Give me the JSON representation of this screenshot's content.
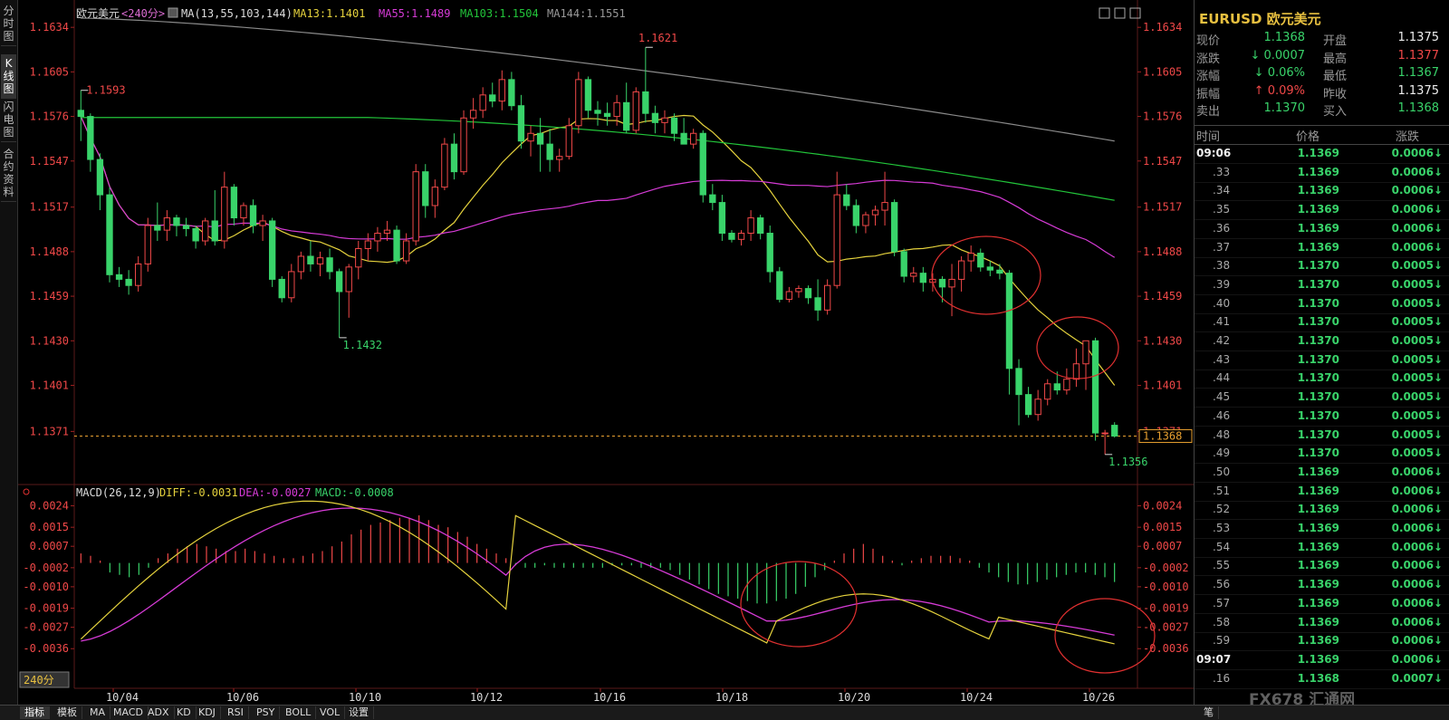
{
  "left_tabs": [
    "分时图",
    "K线图",
    "闪电图",
    "合约资料"
  ],
  "header": {
    "instrument": "欧元美元",
    "period": "<240分>",
    "ma_label": "MA(13,55,103,144)",
    "ma13": "MA13:1.1401",
    "ma55": "MA55:1.1489",
    "ma103": "MA103:1.1504",
    "ma144": "MA144:1.1551"
  },
  "macd_header": {
    "label": "MACD(26,12,9)",
    "diff": "DIFF:-0.0031",
    "dea": "DEA:-0.0027",
    "macd": "MACD:-0.0008"
  },
  "price_axis": [
    "1.1634",
    "1.1605",
    "1.1576",
    "1.1547",
    "1.1517",
    "1.1488",
    "1.1459",
    "1.1430",
    "1.1401",
    "1.1371"
  ],
  "price_axis_right_extra": "1.1368",
  "macd_axis": [
    "0.0024",
    "0.0015",
    "0.0007",
    "-0.0002",
    "-0.0010",
    "-0.0019",
    "-0.0027",
    "-0.0036"
  ],
  "date_labels": [
    "10/04",
    "10/06",
    "10/10",
    "10/12",
    "10/16",
    "10/18",
    "10/20",
    "10/24",
    "10/26"
  ],
  "period_box": "240分",
  "annotations": {
    "high": "1.1621",
    "left_high": "1.1593",
    "low1": "1.1432",
    "low2": "1.1356"
  },
  "colors": {
    "up": "#f04848",
    "down": "#39d36a",
    "ma13": "#e5d23d",
    "ma55": "#d63bd6",
    "ma103": "#22c53a",
    "ma144": "#8a8a8a",
    "circle": "#e03030"
  },
  "chart_data": {
    "type": "candlestick",
    "series_meta": [
      "open",
      "high",
      "low",
      "close"
    ],
    "candles": [
      [
        1.158,
        1.1593,
        1.156,
        1.1576
      ],
      [
        1.1576,
        1.1578,
        1.154,
        1.1548
      ],
      [
        1.1548,
        1.1552,
        1.1515,
        1.1525
      ],
      [
        1.1525,
        1.153,
        1.1468,
        1.1473
      ],
      [
        1.1473,
        1.1478,
        1.1465,
        1.147
      ],
      [
        1.147,
        1.1476,
        1.146,
        1.1466
      ],
      [
        1.1466,
        1.1485,
        1.1462,
        1.148
      ],
      [
        1.148,
        1.151,
        1.1475,
        1.1505
      ],
      [
        1.1505,
        1.152,
        1.1495,
        1.1502
      ],
      [
        1.1502,
        1.1515,
        1.1495,
        1.151
      ],
      [
        1.151,
        1.1512,
        1.1498,
        1.1505
      ],
      [
        1.1505,
        1.151,
        1.1498,
        1.1503
      ],
      [
        1.1503,
        1.1505,
        1.149,
        1.1495
      ],
      [
        1.1495,
        1.151,
        1.1492,
        1.1508
      ],
      [
        1.1508,
        1.1528,
        1.1492,
        1.1495
      ],
      [
        1.1495,
        1.154,
        1.149,
        1.153
      ],
      [
        1.153,
        1.1532,
        1.1505,
        1.151
      ],
      [
        1.151,
        1.152,
        1.1505,
        1.1518
      ],
      [
        1.1518,
        1.1522,
        1.15,
        1.1505
      ],
      [
        1.1505,
        1.1512,
        1.1495,
        1.1508
      ],
      [
        1.1508,
        1.151,
        1.1465,
        1.147
      ],
      [
        1.147,
        1.1472,
        1.1455,
        1.1458
      ],
      [
        1.1458,
        1.148,
        1.1455,
        1.1475
      ],
      [
        1.1475,
        1.1488,
        1.147,
        1.1485
      ],
      [
        1.1485,
        1.1495,
        1.1475,
        1.148
      ],
      [
        1.148,
        1.1488,
        1.1472,
        1.1484
      ],
      [
        1.1484,
        1.149,
        1.147,
        1.1475
      ],
      [
        1.1475,
        1.1477,
        1.1432,
        1.1462
      ],
      [
        1.1462,
        1.148,
        1.1445,
        1.1478
      ],
      [
        1.1478,
        1.1495,
        1.147,
        1.149
      ],
      [
        1.149,
        1.15,
        1.1482,
        1.1495
      ],
      [
        1.1495,
        1.1504,
        1.1488,
        1.15
      ],
      [
        1.15,
        1.1508,
        1.1495,
        1.1502
      ],
      [
        1.1502,
        1.1505,
        1.148,
        1.1482
      ],
      [
        1.1482,
        1.15,
        1.148,
        1.1495
      ],
      [
        1.1495,
        1.1545,
        1.1492,
        1.154
      ],
      [
        1.154,
        1.1545,
        1.151,
        1.1518
      ],
      [
        1.1518,
        1.1535,
        1.151,
        1.153
      ],
      [
        1.153,
        1.1562,
        1.1528,
        1.1558
      ],
      [
        1.1558,
        1.1565,
        1.1535,
        1.154
      ],
      [
        1.154,
        1.158,
        1.1538,
        1.1575
      ],
      [
        1.1575,
        1.1588,
        1.1568,
        1.158
      ],
      [
        1.158,
        1.1595,
        1.1575,
        1.159
      ],
      [
        1.159,
        1.1598,
        1.1582,
        1.1586
      ],
      [
        1.1586,
        1.1606,
        1.158,
        1.16
      ],
      [
        1.16,
        1.1605,
        1.158,
        1.1583
      ],
      [
        1.1583,
        1.159,
        1.1555,
        1.156
      ],
      [
        1.156,
        1.157,
        1.155,
        1.1565
      ],
      [
        1.1565,
        1.1575,
        1.154,
        1.1558
      ],
      [
        1.1558,
        1.1568,
        1.154,
        1.1548
      ],
      [
        1.1548,
        1.1555,
        1.154,
        1.155
      ],
      [
        1.155,
        1.1575,
        1.1548,
        1.157
      ],
      [
        1.157,
        1.1605,
        1.1565,
        1.16
      ],
      [
        1.16,
        1.1602,
        1.1575,
        1.158
      ],
      [
        1.158,
        1.1586,
        1.157,
        1.1578
      ],
      [
        1.1578,
        1.1585,
        1.157,
        1.1576
      ],
      [
        1.1576,
        1.159,
        1.157,
        1.1585
      ],
      [
        1.1585,
        1.1598,
        1.1565,
        1.1567
      ],
      [
        1.1567,
        1.1595,
        1.1565,
        1.1592
      ],
      [
        1.1592,
        1.1621,
        1.1572,
        1.1578
      ],
      [
        1.1578,
        1.1583,
        1.1565,
        1.1572
      ],
      [
        1.1572,
        1.158,
        1.1565,
        1.1575
      ],
      [
        1.1575,
        1.1578,
        1.156,
        1.1565
      ],
      [
        1.1565,
        1.1575,
        1.156,
        1.1558
      ],
      [
        1.1558,
        1.1568,
        1.1555,
        1.1565
      ],
      [
        1.1565,
        1.1567,
        1.152,
        1.1525
      ],
      [
        1.1525,
        1.1532,
        1.1515,
        1.152
      ],
      [
        1.152,
        1.1525,
        1.1495,
        1.15
      ],
      [
        1.15,
        1.1502,
        1.1494,
        1.1496
      ],
      [
        1.1496,
        1.1502,
        1.1492,
        1.15
      ],
      [
        1.15,
        1.1515,
        1.1495,
        1.151
      ],
      [
        1.151,
        1.1512,
        1.1496,
        1.15
      ],
      [
        1.15,
        1.1505,
        1.1468,
        1.1475
      ],
      [
        1.1475,
        1.1478,
        1.1455,
        1.1457
      ],
      [
        1.1457,
        1.1465,
        1.1455,
        1.1462
      ],
      [
        1.1462,
        1.1466,
        1.1458,
        1.1464
      ],
      [
        1.1464,
        1.1466,
        1.1454,
        1.1458
      ],
      [
        1.1458,
        1.147,
        1.1443,
        1.145
      ],
      [
        1.145,
        1.147,
        1.1447,
        1.1466
      ],
      [
        1.1466,
        1.154,
        1.1464,
        1.1525
      ],
      [
        1.1525,
        1.1532,
        1.1515,
        1.1518
      ],
      [
        1.1518,
        1.1522,
        1.15,
        1.1505
      ],
      [
        1.1505,
        1.1514,
        1.15,
        1.1512
      ],
      [
        1.1512,
        1.1518,
        1.1505,
        1.1515
      ],
      [
        1.1515,
        1.154,
        1.1505,
        1.152
      ],
      [
        1.152,
        1.1522,
        1.1485,
        1.1488
      ],
      [
        1.1488,
        1.149,
        1.1468,
        1.1472
      ],
      [
        1.1472,
        1.1478,
        1.1468,
        1.1474
      ],
      [
        1.1474,
        1.1478,
        1.1462,
        1.1468
      ],
      [
        1.1468,
        1.1474,
        1.1462,
        1.147
      ],
      [
        1.147,
        1.1472,
        1.1455,
        1.1465
      ],
      [
        1.1465,
        1.148,
        1.1446,
        1.147
      ],
      [
        1.147,
        1.1485,
        1.1462,
        1.1482
      ],
      [
        1.1482,
        1.1492,
        1.1475,
        1.1487
      ],
      [
        1.1487,
        1.149,
        1.1475,
        1.1478
      ],
      [
        1.1478,
        1.1482,
        1.1472,
        1.1476
      ],
      [
        1.1476,
        1.148,
        1.147,
        1.1474
      ],
      [
        1.1474,
        1.1476,
        1.1395,
        1.1412
      ],
      [
        1.1412,
        1.1418,
        1.1375,
        1.1395
      ],
      [
        1.1395,
        1.14,
        1.138,
        1.1382
      ],
      [
        1.1382,
        1.1398,
        1.1378,
        1.1392
      ],
      [
        1.1392,
        1.1405,
        1.1388,
        1.1402
      ],
      [
        1.1402,
        1.141,
        1.1395,
        1.1398
      ],
      [
        1.1398,
        1.1412,
        1.1395,
        1.1405
      ],
      [
        1.1405,
        1.1425,
        1.14,
        1.1415
      ],
      [
        1.1415,
        1.143,
        1.1398,
        1.143
      ],
      [
        1.143,
        1.1432,
        1.1365,
        1.137
      ],
      [
        1.137,
        1.1372,
        1.1356,
        1.137
      ],
      [
        1.1375,
        1.1377,
        1.1367,
        1.1368
      ]
    ],
    "ylim": [
      1.135,
      1.164
    ],
    "macd_ylim": [
      -0.0042,
      0.0028
    ],
    "macd_hist": [
      0.0004,
      0.0003,
      0.0001,
      -0.0004,
      -0.0005,
      -0.0006,
      -0.0005,
      -0.0002,
      0.0002,
      0.0004,
      0.0006,
      0.0007,
      0.0008,
      0.0007,
      0.0006,
      0.0005,
      0.0005,
      0.0006,
      0.0005,
      0.0004,
      0.0003,
      0.0002,
      0.0002,
      0.0003,
      0.0004,
      0.0005,
      0.0007,
      0.0009,
      0.0012,
      0.0014,
      0.0016,
      0.0017,
      0.0018,
      0.0019,
      0.0019,
      0.002,
      0.0018,
      0.0016,
      0.0015,
      0.0013,
      0.0011,
      0.0008,
      0.0006,
      0.0004,
      0.0002,
      -0.0001,
      -0.0002,
      -0.0002,
      -0.0001,
      -0.0002,
      -0.0002,
      -0.0002,
      -0.0002,
      -0.0002,
      -0.0002,
      -0.0001,
      -0.0001,
      -0.0001,
      -0.0002,
      -0.0002,
      -0.0002,
      -0.0003,
      -0.0005,
      -0.0007,
      -0.0009,
      -0.0011,
      -0.0013,
      -0.0014,
      -0.0015,
      -0.0016,
      -0.0017,
      -0.0017,
      -0.0016,
      -0.0015,
      -0.0013,
      -0.001,
      -0.0006,
      -0.0003,
      0.0001,
      0.0004,
      0.0006,
      0.0008,
      0.0006,
      0.0003,
      0.0001,
      -0.0001,
      0.0001,
      0.0002,
      0.0003,
      0.0003,
      0.0003,
      0.0002,
      0.0001,
      -0.0002,
      -0.0004,
      -0.0006,
      -0.0008,
      -0.0009,
      -0.0009,
      -0.0008,
      -0.0007,
      -0.0006,
      -0.0005,
      -0.0004,
      -0.0004,
      -0.0005,
      -0.0006,
      -0.0008
    ]
  },
  "right_panel": {
    "title": "EURUSD 欧元美元",
    "quote_rows": [
      {
        "l1": "现价",
        "v1": "1.1368",
        "c1": "green",
        "l2": "开盘",
        "v2": "1.1375",
        "c2": "white"
      },
      {
        "l1": "涨跌",
        "v1": "↓ 0.0007",
        "c1": "green",
        "l2": "最高",
        "v2": "1.1377",
        "c2": "red"
      },
      {
        "l1": "涨幅",
        "v1": "↓ 0.06%",
        "c1": "green",
        "l2": "最低",
        "v2": "1.1367",
        "c2": "green"
      },
      {
        "l1": "振幅",
        "v1": "↑ 0.09%",
        "c1": "red",
        "l2": "昨收",
        "v2": "1.1375",
        "c2": "white"
      },
      {
        "l1": "卖出",
        "v1": "1.1370",
        "c1": "green",
        "l2": "买入",
        "v2": "1.1368",
        "c2": "green"
      }
    ],
    "tick_header": {
      "time": "时间",
      "price": "价格",
      "change": "涨跌"
    },
    "ticks": [
      {
        "t": "09:06",
        "p": "1.1369",
        "c": "0.0006↓"
      },
      {
        "t": ".33",
        "p": "1.1369",
        "c": "0.0006↓"
      },
      {
        "t": ".34",
        "p": "1.1369",
        "c": "0.0006↓"
      },
      {
        "t": ".35",
        "p": "1.1369",
        "c": "0.0006↓"
      },
      {
        "t": ".36",
        "p": "1.1369",
        "c": "0.0006↓"
      },
      {
        "t": ".37",
        "p": "1.1369",
        "c": "0.0006↓"
      },
      {
        "t": ".38",
        "p": "1.1370",
        "c": "0.0005↓"
      },
      {
        "t": ".39",
        "p": "1.1370",
        "c": "0.0005↓"
      },
      {
        "t": ".40",
        "p": "1.1370",
        "c": "0.0005↓"
      },
      {
        "t": ".41",
        "p": "1.1370",
        "c": "0.0005↓"
      },
      {
        "t": ".42",
        "p": "1.1370",
        "c": "0.0005↓"
      },
      {
        "t": ".43",
        "p": "1.1370",
        "c": "0.0005↓"
      },
      {
        "t": ".44",
        "p": "1.1370",
        "c": "0.0005↓"
      },
      {
        "t": ".45",
        "p": "1.1370",
        "c": "0.0005↓"
      },
      {
        "t": ".46",
        "p": "1.1370",
        "c": "0.0005↓"
      },
      {
        "t": ".48",
        "p": "1.1370",
        "c": "0.0005↓"
      },
      {
        "t": ".49",
        "p": "1.1370",
        "c": "0.0005↓"
      },
      {
        "t": ".50",
        "p": "1.1369",
        "c": "0.0006↓"
      },
      {
        "t": ".51",
        "p": "1.1369",
        "c": "0.0006↓"
      },
      {
        "t": ".52",
        "p": "1.1369",
        "c": "0.0006↓"
      },
      {
        "t": ".53",
        "p": "1.1369",
        "c": "0.0006↓"
      },
      {
        "t": ".54",
        "p": "1.1369",
        "c": "0.0006↓"
      },
      {
        "t": ".55",
        "p": "1.1369",
        "c": "0.0006↓"
      },
      {
        "t": ".56",
        "p": "1.1369",
        "c": "0.0006↓"
      },
      {
        "t": ".57",
        "p": "1.1369",
        "c": "0.0006↓"
      },
      {
        "t": ".58",
        "p": "1.1369",
        "c": "0.0006↓"
      },
      {
        "t": ".59",
        "p": "1.1369",
        "c": "0.0006↓"
      },
      {
        "t": "09:07",
        "p": "1.1369",
        "c": "0.0006↓"
      },
      {
        "t": ".16",
        "p": "1.1368",
        "c": "0.0007↓"
      }
    ],
    "watermark": "FX678 汇通网"
  },
  "bottom_tabs": [
    "指标",
    "模板",
    "MA",
    "MACD",
    "ADX",
    "KD",
    "KDJ",
    "RSI",
    "PSY",
    "BOLL",
    "VOL",
    "设置"
  ],
  "bottom_right_tab": "笔"
}
